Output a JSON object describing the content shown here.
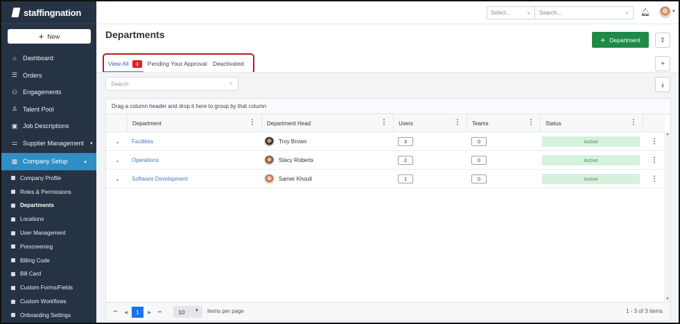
{
  "app": {
    "brand": "staffingnation"
  },
  "sidebar": {
    "new_label": "New",
    "items": [
      {
        "label": "Dashboard",
        "icon": "home-icon"
      },
      {
        "label": "Orders",
        "icon": "list-icon"
      },
      {
        "label": "Engagements",
        "icon": "people-icon"
      },
      {
        "label": "Talent Pool",
        "icon": "person-icon"
      },
      {
        "label": "Job Descriptions",
        "icon": "calendar-icon"
      },
      {
        "label": "Supplier Management",
        "icon": "org-chart-icon"
      },
      {
        "label": "Company Setup",
        "icon": "building-icon"
      }
    ],
    "sub_items": [
      "Company Profile",
      "Roles & Permissions",
      "Departments",
      "Locations",
      "User Management",
      "Prescreening",
      "Billing Code",
      "Bill Card",
      "Custom Forms/Fields",
      "Custom Workflows",
      "Onboarding Settings"
    ]
  },
  "topbar": {
    "select_placeholder": "Select...",
    "search_placeholder": "Search..."
  },
  "page": {
    "title": "Departments",
    "add_button": "Department"
  },
  "tabs": [
    {
      "label": "View All",
      "badge": "3"
    },
    {
      "label": "Pending Your Approval"
    },
    {
      "label": "Deactivated"
    }
  ],
  "grid": {
    "search_placeholder": "Search",
    "group_hint": "Drag a column header and drop it here to group by that column",
    "columns": [
      "Department",
      "Department Head",
      "Users",
      "Teams",
      "Status"
    ],
    "rows": [
      {
        "department": "Facilities",
        "head": "Troy Brown",
        "users": "3",
        "teams": "0",
        "status": "Active"
      },
      {
        "department": "Operations",
        "head": "Stacy Roberts",
        "users": "2",
        "teams": "0",
        "status": "Active"
      },
      {
        "department": "Software Development",
        "head": "Samer Khouli",
        "users": "1",
        "teams": "0",
        "status": "Active"
      }
    ],
    "pager": {
      "current_page": "1",
      "page_size": "10",
      "per_page_label": "items per page",
      "info": "1 - 3 of 3 items"
    }
  },
  "colors": {
    "sidebar": "#253344",
    "active_nav": "#2f8ec4",
    "primary_button": "#1e8a45",
    "badge": "#e02020",
    "status_bg": "#d6f1dc"
  }
}
